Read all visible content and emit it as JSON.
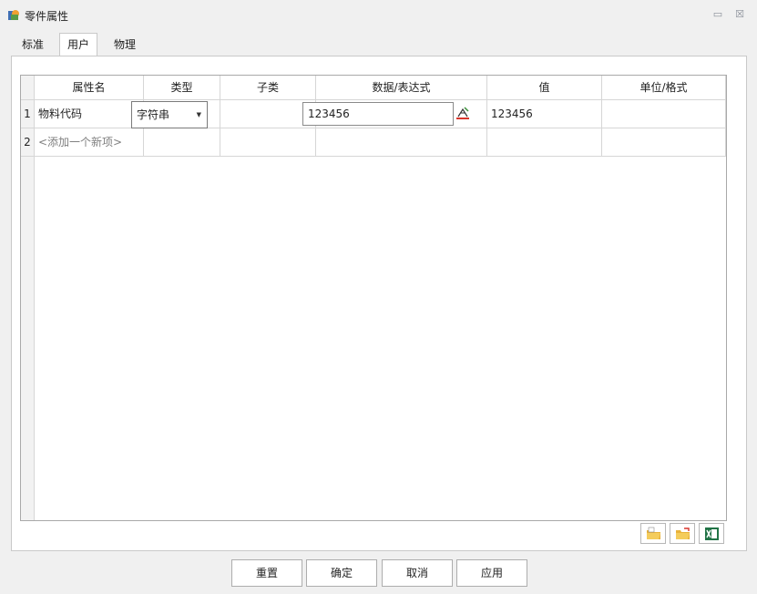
{
  "window": {
    "title": "零件属性",
    "minimize_glyph": "▭",
    "close_glyph": "☒"
  },
  "tabs": [
    {
      "label": "标准",
      "active": false
    },
    {
      "label": "用户",
      "active": true
    },
    {
      "label": "物理",
      "active": false
    }
  ],
  "table": {
    "columns": [
      "属性名",
      "类型",
      "子类",
      "数据/表达式",
      "值",
      "单位/格式"
    ],
    "rows": [
      {
        "index": "1",
        "name": "物料代码",
        "type": "字符串",
        "subtype": "",
        "expression": "123456",
        "value": "123456",
        "unit": ""
      },
      {
        "index": "2",
        "name": "<添加一个新项>",
        "type": "",
        "subtype": "",
        "expression": "",
        "value": "",
        "unit": ""
      }
    ]
  },
  "toolbar_icons": [
    "import-folder-icon",
    "export-folder-icon",
    "excel-icon"
  ],
  "buttons": {
    "reset": "重置",
    "ok": "确定",
    "cancel": "取消",
    "apply": "应用"
  },
  "colors": {
    "accent_formula_red": "#d9342b",
    "excel_green": "#217346",
    "folder_yellow": "#e9b23a"
  }
}
